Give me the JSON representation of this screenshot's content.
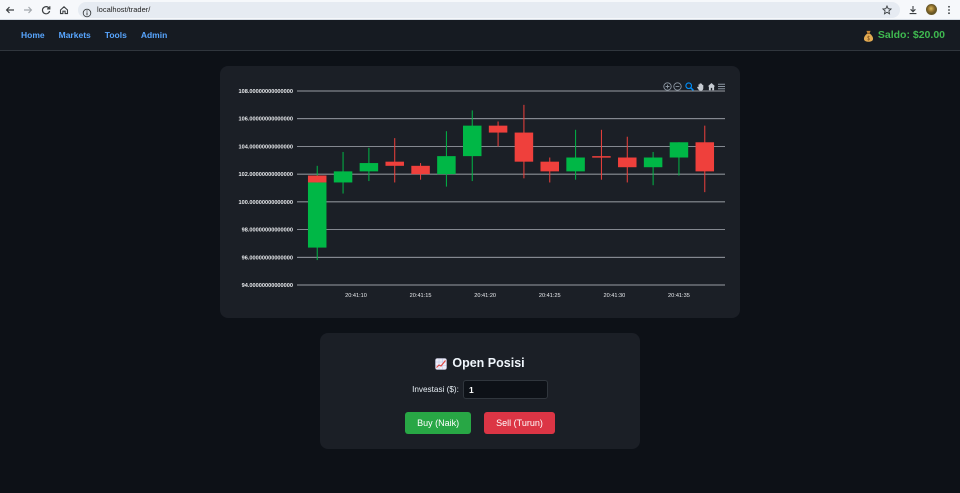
{
  "browser": {
    "url": "localhost/trader/",
    "toolbar_icons": [
      "back-icon",
      "forward-icon",
      "reload-icon",
      "home-icon",
      "site-info-icon",
      "bookmark-star-icon",
      "download-icon",
      "profile-avatar",
      "more-menu-icon"
    ]
  },
  "nav": {
    "items": [
      {
        "label": "Home"
      },
      {
        "label": "Markets"
      },
      {
        "label": "Tools"
      },
      {
        "label": "Admin"
      }
    ],
    "balance": {
      "icon": "money-bag-icon",
      "text": "Saldo: $20.00"
    }
  },
  "chart_toolbar": {
    "icons": [
      "zoom-in-icon",
      "zoom-out-icon",
      "zoom-select-icon",
      "pan-icon",
      "reset-zoom-icon",
      "chart-menu-icon"
    ],
    "active": "zoom-select-icon"
  },
  "chart_data": {
    "type": "candlestick",
    "ylim": [
      94,
      108
    ],
    "grid": true,
    "y_ticks": [
      "108.00000000000000",
      "106.00000000000000",
      "104.00000000000000",
      "102.00000000000000",
      "100.00000000000000",
      "98.00000000000000",
      "96.00000000000000",
      "94.00000000000000"
    ],
    "x_ticks": [
      "20:41:10",
      "20:41:15",
      "20:41:20",
      "20:41:25",
      "20:41:30",
      "20:41:35"
    ],
    "candles": [
      {
        "x": "20:41:07",
        "o": 96.7,
        "h": 102.6,
        "l": 95.8,
        "c": 101.4
      },
      {
        "x": "20:41:07",
        "o": 101.9,
        "h": 101.9,
        "l": 101.4,
        "c": 101.4
      },
      {
        "x": "20:41:09",
        "o": 101.4,
        "h": 103.6,
        "l": 100.6,
        "c": 102.2
      },
      {
        "x": "20:41:11",
        "o": 102.2,
        "h": 103.9,
        "l": 101.5,
        "c": 102.8
      },
      {
        "x": "20:41:13",
        "o": 102.9,
        "h": 104.6,
        "l": 101.4,
        "c": 102.6
      },
      {
        "x": "20:41:15",
        "o": 102.6,
        "h": 102.8,
        "l": 101.6,
        "c": 102.0
      },
      {
        "x": "20:41:17",
        "o": 102.0,
        "h": 105.1,
        "l": 101.1,
        "c": 103.3
      },
      {
        "x": "20:41:19",
        "o": 103.3,
        "h": 106.6,
        "l": 101.5,
        "c": 105.5
      },
      {
        "x": "20:41:21",
        "o": 105.5,
        "h": 105.8,
        "l": 104.0,
        "c": 105.0
      },
      {
        "x": "20:41:23",
        "o": 105.0,
        "h": 107.0,
        "l": 101.7,
        "c": 102.9
      },
      {
        "x": "20:41:25",
        "o": 102.9,
        "h": 103.2,
        "l": 101.4,
        "c": 102.2
      },
      {
        "x": "20:41:27",
        "o": 102.2,
        "h": 105.2,
        "l": 101.6,
        "c": 103.2
      },
      {
        "x": "20:41:29",
        "o": 103.3,
        "h": 105.2,
        "l": 101.6,
        "c": 103.2
      },
      {
        "x": "20:41:31",
        "o": 103.2,
        "h": 104.7,
        "l": 101.4,
        "c": 102.5
      },
      {
        "x": "20:41:33",
        "o": 102.5,
        "h": 103.6,
        "l": 101.2,
        "c": 103.2
      },
      {
        "x": "20:41:35",
        "o": 103.2,
        "h": 104.3,
        "l": 101.9,
        "c": 104.3
      },
      {
        "x": "20:41:37",
        "o": 104.3,
        "h": 105.5,
        "l": 100.7,
        "c": 102.2
      }
    ]
  },
  "order_form": {
    "title_icon": "chart-increasing-icon",
    "title": "Open Posisi",
    "investment_label": "Investasi ($):",
    "investment_value": "1",
    "buy_label": "Buy (Naik)",
    "sell_label": "Sell (Turun)"
  },
  "colors": {
    "page_bg": "#0d1117",
    "panel_bg": "#1b1f26",
    "nav_link": "#58a6ff",
    "balance": "#3fb950",
    "candle_up": "#00b746",
    "candle_down": "#ef403c",
    "toolbar_active": "#008ffb",
    "buy_button": "#28a745",
    "sell_button": "#dc3545"
  }
}
